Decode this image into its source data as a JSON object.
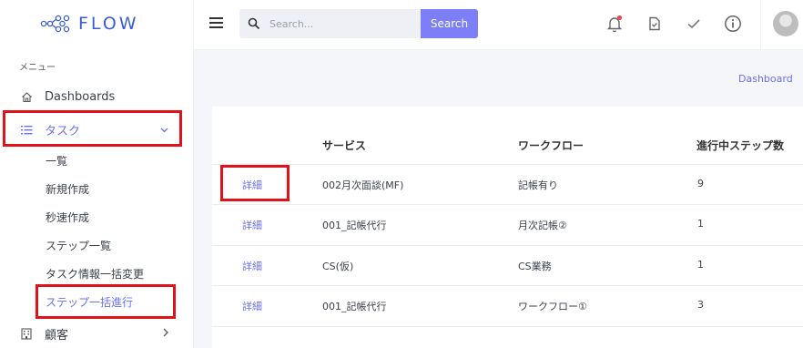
{
  "app": {
    "logo_text": "FLOW"
  },
  "sidebar": {
    "section_label": "メニュー",
    "items": [
      {
        "label": "Dashboards",
        "icon": "home-icon"
      },
      {
        "label": "タスク",
        "icon": "list-icon",
        "expanded": true
      },
      {
        "label": "顧客",
        "icon": "building-icon"
      }
    ],
    "sub_items": [
      {
        "label": "一覧"
      },
      {
        "label": "新規作成"
      },
      {
        "label": "秒速作成"
      },
      {
        "label": "ステップ一覧"
      },
      {
        "label": "タスク情報一括変更"
      },
      {
        "label": "ステップ一括進行"
      }
    ]
  },
  "topbar": {
    "search_placeholder": "Search...",
    "search_button": "Search",
    "icons": [
      "bell-icon",
      "document-icon",
      "check-icon",
      "info-icon"
    ]
  },
  "breadcrumb": "Dashboard",
  "table": {
    "headers": [
      "",
      "サービス",
      "ワークフロー",
      "進行中ステップ数"
    ],
    "rows": [
      {
        "action": "詳細",
        "service": "002月次面談(MF)",
        "workflow": "記帳有り",
        "steps": "9"
      },
      {
        "action": "詳細",
        "service": "001_記帳代行",
        "workflow": "月次記帳②",
        "steps": "1"
      },
      {
        "action": "詳細",
        "service": "CS(仮)",
        "workflow": "CS業務",
        "steps": "1"
      },
      {
        "action": "詳細",
        "service": "001_記帳代行",
        "workflow": "ワークフロー①",
        "steps": "3"
      }
    ]
  },
  "colors": {
    "accent": "#6b6ff5",
    "button": "#7c7ff7",
    "highlight": "#e0131b",
    "notification_dot": "#e74c5b"
  }
}
